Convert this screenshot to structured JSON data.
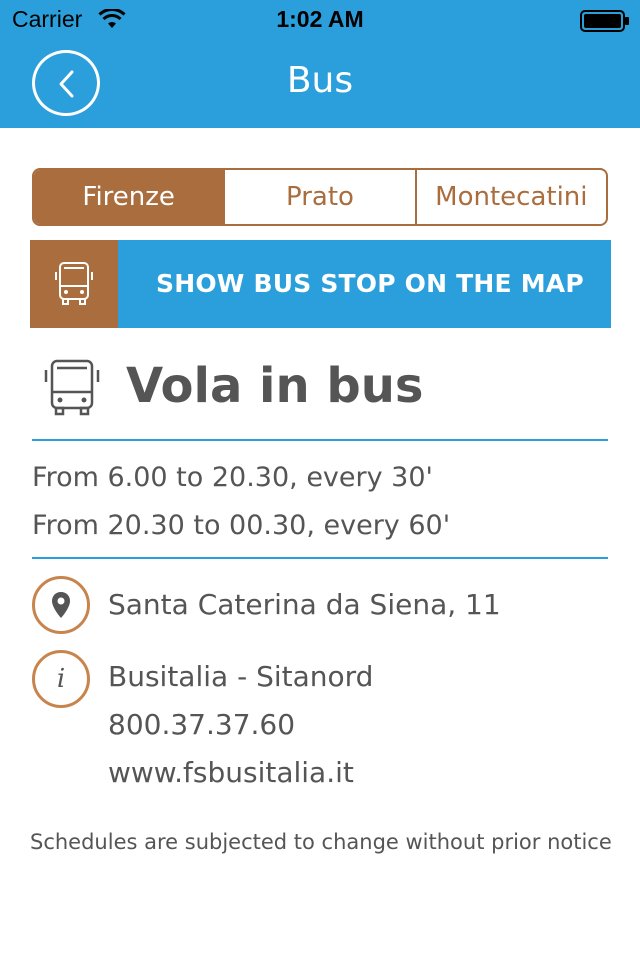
{
  "status_bar": {
    "carrier": "Carrier",
    "time": "1:02 AM"
  },
  "nav": {
    "title": "Bus",
    "back_icon": "chevron-left-icon"
  },
  "city_tabs": [
    {
      "label": "Firenze",
      "selected": true
    },
    {
      "label": "Prato",
      "selected": false
    },
    {
      "label": "Montecatini",
      "selected": false
    }
  ],
  "map_button": {
    "label": "SHOW BUS STOP ON THE MAP",
    "icon": "bus-icon"
  },
  "line": {
    "name": "Vola in bus",
    "icon": "bus-icon"
  },
  "schedule": [
    "From 6.00 to 20.30, every 30'",
    "From 20.30 to 00.30, every 60'"
  ],
  "address": {
    "icon": "location-pin-icon",
    "text": "Santa Caterina da Siena, 11"
  },
  "operator": {
    "icon": "info-icon",
    "icon_glyph": "i",
    "name": "Busitalia - Sitanord",
    "phone": "800.37.37.60",
    "website": "www.fsbusitalia.it"
  },
  "footer_note": "Schedules are subjected to change without prior notice",
  "colors": {
    "primary_blue": "#2a9fdb",
    "accent_brown": "#a96d3e",
    "text": "#555555"
  }
}
